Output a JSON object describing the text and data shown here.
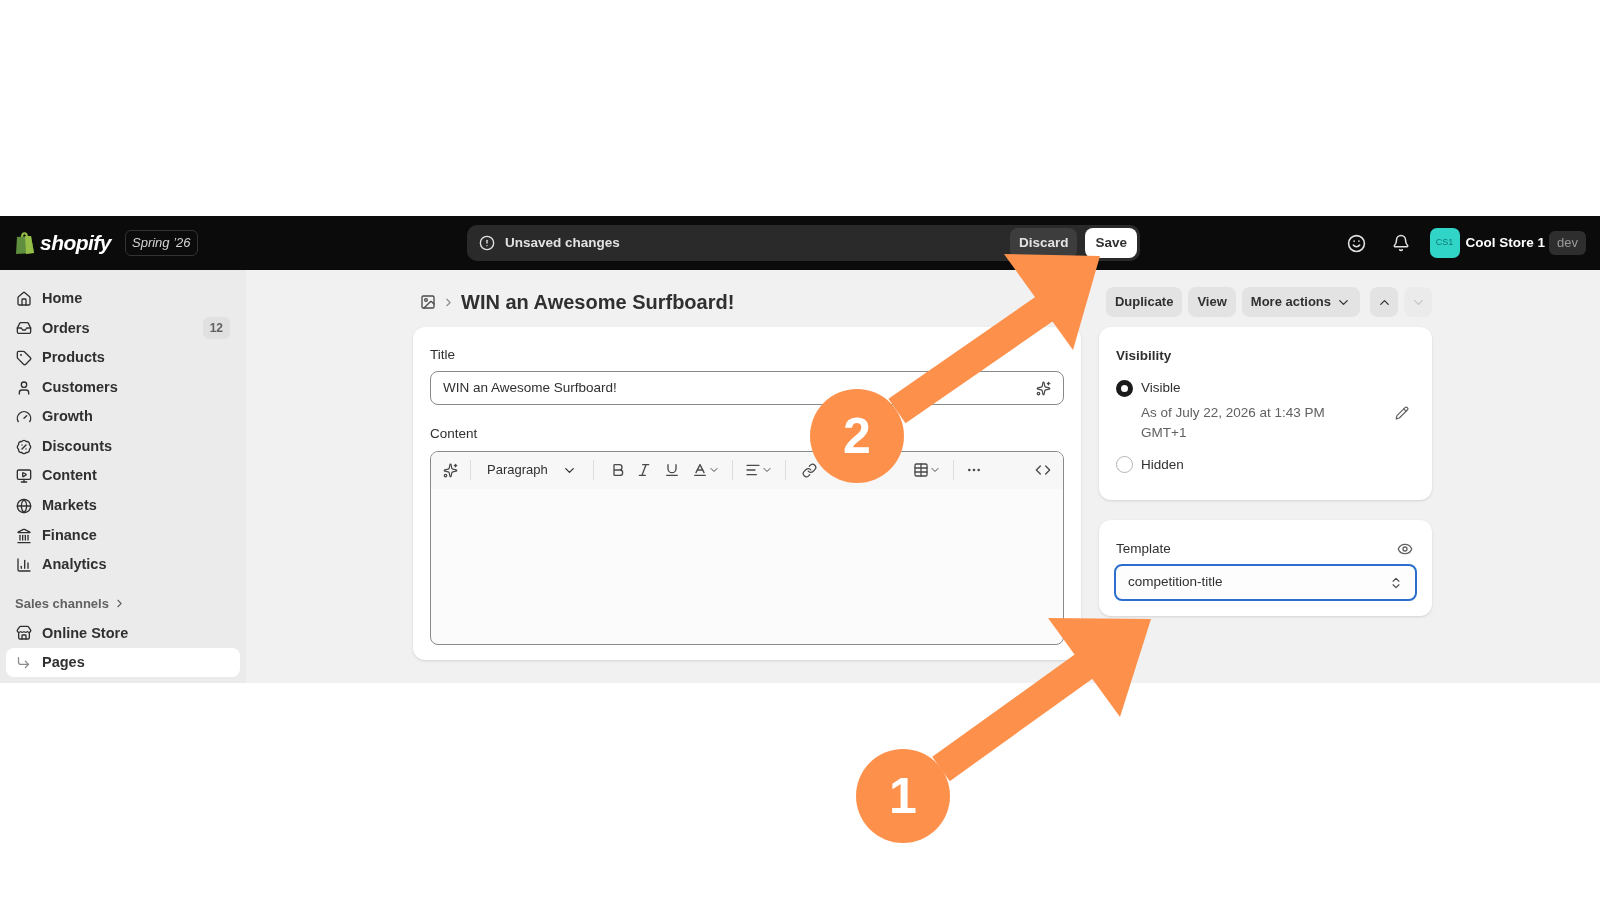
{
  "topbar": {
    "logo": "shopify",
    "edition": "Spring ’26",
    "unsaved_bar": {
      "message": "Unsaved changes",
      "buttons": [
        {
          "label": "Discard",
          "kind": "secondary"
        },
        {
          "label": "Save",
          "kind": "primary"
        }
      ]
    },
    "store": {
      "avatar": "CS1",
      "name": "Cool Store 1",
      "badge": "dev"
    }
  },
  "sidebar": {
    "items": [
      {
        "label": "Home",
        "selected": false
      },
      {
        "label": "Orders",
        "badge": "12",
        "selected": false
      },
      {
        "label": "Products",
        "selected": false
      },
      {
        "label": "Customers",
        "selected": false
      },
      {
        "label": "Growth",
        "selected": false
      },
      {
        "label": "Discounts",
        "selected": false
      },
      {
        "label": "Content",
        "selected": false
      },
      {
        "label": "Markets",
        "selected": false
      },
      {
        "label": "Finance",
        "selected": false
      },
      {
        "label": "Analytics",
        "selected": false
      }
    ],
    "section": "Sales channels",
    "channels": [
      {
        "label": "Online Store",
        "selected": false,
        "children": [
          {
            "label": "Pages",
            "selected": true
          }
        ]
      }
    ]
  },
  "page": {
    "title": "WIN an Awesome Surfboard!",
    "actions": [
      {
        "label": "Duplicate"
      },
      {
        "label": "View"
      },
      {
        "label": "More actions",
        "kind": "menu"
      }
    ],
    "pager": [
      {
        "disabled": false
      },
      {
        "disabled": true
      }
    ],
    "title_field": {
      "label": "Title",
      "value": "WIN an Awesome Surfboard!"
    },
    "content": {
      "label": "Content",
      "format": "Paragraph"
    }
  },
  "visibility": {
    "heading": "Visibility",
    "options": [
      {
        "label": "Visible",
        "note": "As of July 22, 2026 at 1:43 PM GMT+1",
        "selected": true
      },
      {
        "label": "Hidden",
        "selected": false
      }
    ]
  },
  "template": {
    "label": "Template",
    "value": "competition-title"
  },
  "annotations": [
    {
      "number": "1"
    },
    {
      "number": "2"
    }
  ]
}
